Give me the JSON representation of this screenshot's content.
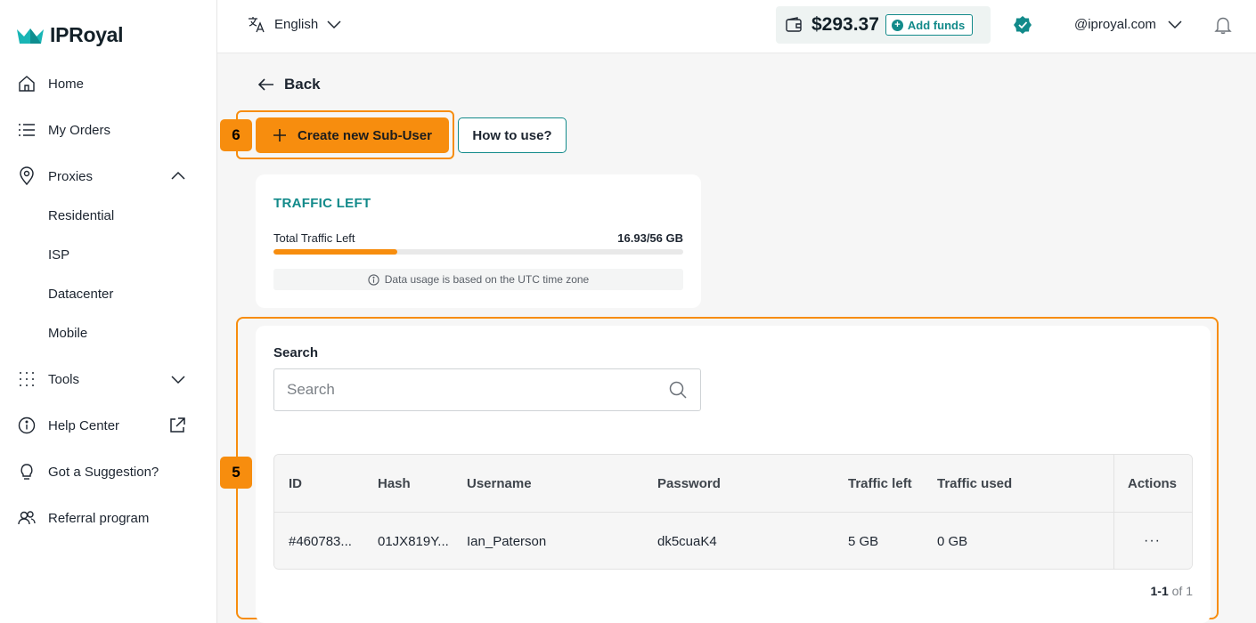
{
  "brand": {
    "name": "IPRoyal",
    "accent": "#128a8a",
    "highlight": "#f78d0e"
  },
  "sidebar": {
    "items": [
      {
        "label": "Home"
      },
      {
        "label": "My Orders"
      },
      {
        "label": "Proxies"
      },
      {
        "label": "Tools"
      },
      {
        "label": "Help Center"
      },
      {
        "label": "Got a Suggestion?"
      },
      {
        "label": "Referral program"
      }
    ],
    "proxies_sub": [
      "Residential",
      "ISP",
      "Datacenter",
      "Mobile"
    ]
  },
  "topbar": {
    "language": "English",
    "balance": "$293.37",
    "add_funds": "Add funds",
    "account": "@iproyal.com"
  },
  "main": {
    "back": "Back",
    "create_button": "Create new Sub-User",
    "how_button": "How to use?",
    "step_badges": [
      "6",
      "5"
    ],
    "traffic": {
      "title": "TRAFFIC LEFT",
      "label": "Total Traffic Left",
      "value": "16.93/56 GB",
      "remaining_fraction": 0.302,
      "note": "Data usage is based on the UTC time zone"
    },
    "search": {
      "label": "Search",
      "placeholder": "Search"
    },
    "table": {
      "columns": [
        "ID",
        "Hash",
        "Username",
        "Password",
        "Traffic left",
        "Traffic used",
        "Actions"
      ],
      "rows": [
        {
          "id": "#460783...",
          "hash": "01JX819Y...",
          "username": "Ian_Paterson",
          "password": "dk5cuaK4",
          "traffic_left": "5 GB",
          "traffic_used": "0 GB",
          "actions": "···"
        }
      ]
    },
    "pager": {
      "range": "1-1",
      "of": "of 1"
    }
  }
}
